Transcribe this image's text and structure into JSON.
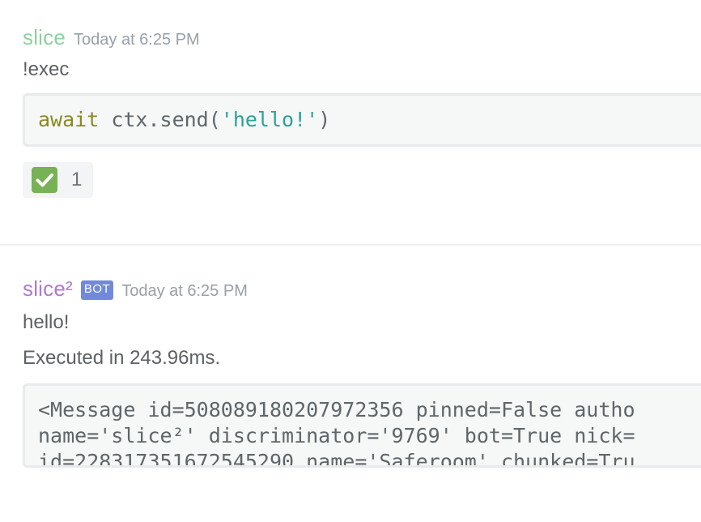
{
  "messages": [
    {
      "author": "slice",
      "timestamp": "Today at 6:25 PM",
      "content": "!exec",
      "code": {
        "keyword": "await",
        "before_string": " ctx.send(",
        "string": "'hello!'",
        "after_string": ")"
      },
      "reaction": {
        "emoji": "white-check-mark-icon",
        "count": "1"
      }
    },
    {
      "author": "slice²",
      "bot_tag": "BOT",
      "timestamp": "Today at 6:25 PM",
      "lines": [
        "hello!",
        "Executed in 243.96ms."
      ],
      "code_lines": [
        "<Message id=508089180207972356 pinned=False autho",
        "name='slice²' discriminator='9769' bot=True nick=",
        "id=228317351672545290 name='Saferoom' chunked=Tru"
      ]
    }
  ],
  "colors": {
    "user_name": "#8fd0a0",
    "bot_name": "#b07acc",
    "bot_tag_bg": "#7289da",
    "timestamp": "#99a0a8",
    "code_keyword": "#8a8a1f",
    "code_string": "#2aa198",
    "reaction_check": "#77b255"
  }
}
